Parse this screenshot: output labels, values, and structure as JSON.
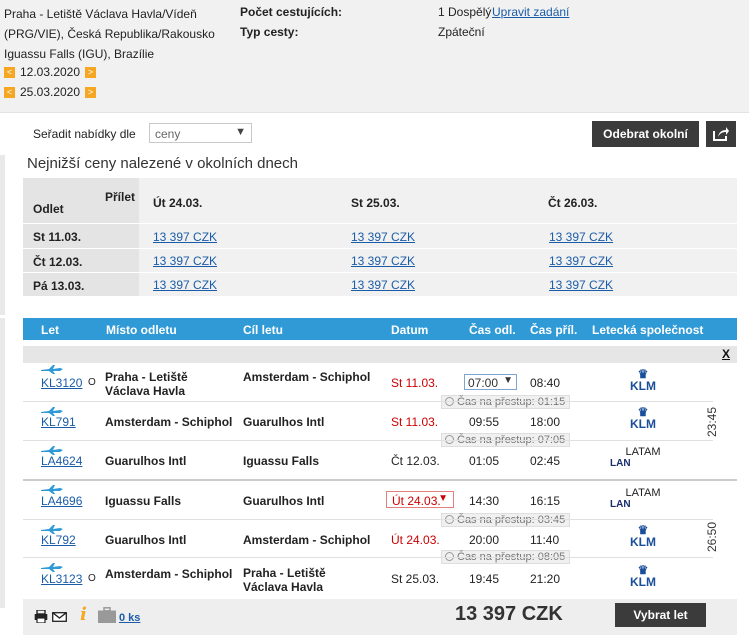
{
  "summary": {
    "route_line1": "Praha - Letiště Václava Havla/Vídeň",
    "route_line2": "(PRG/VIE), Česká Republika/Rakousko",
    "route_line3": "Iguassu Falls (IGU), Brazílie",
    "date_out": "12.03.2020",
    "date_back": "25.03.2020",
    "passengers_label": "Počet cestujících:",
    "passengers_value": "1 Dospělý",
    "edit_link": "Upravit zadání",
    "trip_type_label": "Typ cesty:",
    "trip_type_value": "Zpáteční"
  },
  "sort": {
    "label": "Seřadit nabídky dle",
    "value": "ceny"
  },
  "buttons": {
    "remove_nearby": "Odebrat okolní dny",
    "select_flight": "Vybrat let"
  },
  "nearby": {
    "title": "Nejnižší ceny nalezené v okolních dnech",
    "departure_label": "Odlet",
    "arrival_label": "Přílet",
    "columns": [
      "Út 24.03.",
      "St 25.03.",
      "Čt 26.03."
    ],
    "rows": [
      {
        "label": "St 11.03.",
        "prices": [
          "13 397 CZK",
          "13 397 CZK",
          "13 397 CZK"
        ]
      },
      {
        "label": "Čt 12.03.",
        "prices": [
          "13 397 CZK",
          "13 397 CZK",
          "13 397 CZK"
        ]
      },
      {
        "label": "Pá 13.03.",
        "prices": [
          "13 397 CZK",
          "13 397 CZK",
          "13 397 CZK"
        ]
      }
    ]
  },
  "table": {
    "headers": [
      "Let",
      "Místo odletu",
      "Cíl letu",
      "Datum",
      "Čas odl.",
      "Čas příl.",
      "Letecká společnost"
    ],
    "close": "X",
    "outbound": [
      {
        "flight": "KL3120",
        "marker": "O",
        "from": "Praha - Letiště Václava Havla",
        "to": "Amsterdam - Schiphol",
        "date": "St 11.03.",
        "dep": "07:00",
        "arr": "08:40",
        "airline": "KLM",
        "airline_logo": "KLM"
      },
      {
        "flight": "KL791",
        "marker": "",
        "from": "Amsterdam - Schiphol",
        "to": "Guarulhos Intl",
        "date": "St 11.03.",
        "dep": "09:55",
        "arr": "18:00",
        "airline": "KLM",
        "airline_logo": "KLM"
      },
      {
        "flight": "LA4624",
        "marker": "",
        "from": "Guarulhos Intl",
        "to": "Iguassu Falls",
        "date": "Čt 12.03.",
        "dep": "01:05",
        "arr": "02:45",
        "airline": "LATAM",
        "airline_logo": "LAN"
      }
    ],
    "outbound_transfers": [
      "Čas na přestup: 01:15",
      "Čas na přestup: 07:05"
    ],
    "outbound_duration": "23:45",
    "inbound": [
      {
        "flight": "LA4696",
        "marker": "",
        "from": "Iguassu Falls",
        "to": "Guarulhos Intl",
        "date": "Út 24.03.",
        "dep": "14:30",
        "arr": "16:15",
        "airline": "LATAM",
        "airline_logo": "LAN"
      },
      {
        "flight": "KL792",
        "marker": "",
        "from": "Guarulhos Intl",
        "to": "Amsterdam - Schiphol",
        "date": "Út 24.03.",
        "dep": "20:00",
        "arr": "11:40",
        "airline": "KLM",
        "airline_logo": "KLM"
      },
      {
        "flight": "KL3123",
        "marker": "O",
        "from": "Amsterdam - Schiphol",
        "to": "Praha - Letiště Václava Havla",
        "date": "St 25.03.",
        "dep": "19:45",
        "arr": "21:20",
        "airline": "KLM",
        "airline_logo": "KLM"
      }
    ],
    "inbound_transfers": [
      "Čas na přestup: 03:45",
      "Čas na přestup: 08:05"
    ],
    "inbound_duration": "26:50"
  },
  "footer": {
    "bag_count": "0 ks",
    "price": "13 397 CZK"
  },
  "colors": {
    "header_blue": "#2f9ad6",
    "accent_orange": "#f5a623",
    "date_red": "#cc0000",
    "link_blue": "#1a5ca8"
  }
}
